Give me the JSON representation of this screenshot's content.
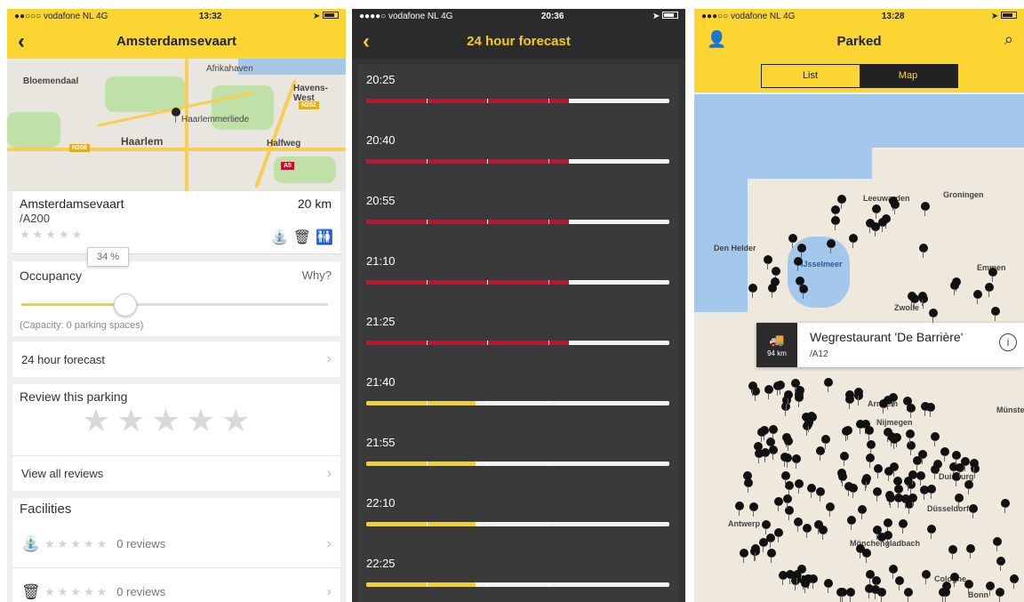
{
  "colors": {
    "brand_yellow": "#fbd632",
    "dark": "#2b2b2b",
    "high": "#c8102e",
    "low": "#f3d12b"
  },
  "p1": {
    "status": {
      "carrier": "●●○○○ vodafone NL  4G",
      "time": "13:32"
    },
    "title": "Amsterdamsevaart",
    "back_icon": "chevron-left-icon",
    "map_labels": [
      "Bloemendaal",
      "Haarlemmerliede",
      "Haarlem",
      "Halfweg",
      "Afrikahaven",
      "Havens-West"
    ],
    "map_shields": [
      "N208",
      "A5",
      "N202"
    ],
    "name": "Amsterdamsevaart",
    "route": "/A200",
    "distance": "20 km",
    "stars": "★★★★★",
    "occupancy_label": "Occupancy",
    "why": "Why?",
    "occupancy_pct": "34 %",
    "occupancy_value": 34,
    "capacity": "(Capacity: 0 parking spaces)",
    "forecast_link": "24 hour forecast",
    "review_title": "Review this parking",
    "review_stars": "★★★★★",
    "view_reviews": "View all reviews",
    "facilities_title": "Facilities",
    "facilities": [
      {
        "icon": "tap-icon",
        "glyph": "⛲",
        "stars": "★★★★★",
        "reviews": "0 reviews"
      },
      {
        "icon": "trash-icon",
        "glyph": "🗑",
        "stars": "★★★★★",
        "reviews": "0 reviews"
      }
    ]
  },
  "p2": {
    "status": {
      "carrier": "●●●●○ vodafone NL  4G",
      "time": "20:36"
    },
    "title": "24 hour forecast",
    "rows": [
      {
        "time": "20:25",
        "level": "high",
        "fill": 0.67
      },
      {
        "time": "20:40",
        "level": "high",
        "fill": 0.67
      },
      {
        "time": "20:55",
        "level": "high",
        "fill": 0.67
      },
      {
        "time": "21:10",
        "level": "high",
        "fill": 0.67
      },
      {
        "time": "21:25",
        "level": "high",
        "fill": 0.67
      },
      {
        "time": "21:40",
        "level": "low",
        "fill": 0.36
      },
      {
        "time": "21:55",
        "level": "low",
        "fill": 0.36
      },
      {
        "time": "22:10",
        "level": "low",
        "fill": 0.36
      },
      {
        "time": "22:25",
        "level": "low",
        "fill": 0.36
      }
    ]
  },
  "p3": {
    "status": {
      "carrier": "●●●○○ vodafone NL  4G",
      "time": "13:28"
    },
    "title": "Parked",
    "segments": [
      "List",
      "Map"
    ],
    "map_labels": [
      "Den Helder",
      "Leeuwarden",
      "Groningen",
      "IJsselmeer",
      "Zwolle",
      "Emmen",
      "Arnhem",
      "Nijmegen",
      "Duisburg",
      "Düsseldorf",
      "Antwerp",
      "Mönchengladbach",
      "Cologne",
      "Bonn",
      "Münster"
    ],
    "callout": {
      "distance": "94 km",
      "name": "Wegrestaurant 'De Barrière'",
      "route": "/A12"
    }
  }
}
